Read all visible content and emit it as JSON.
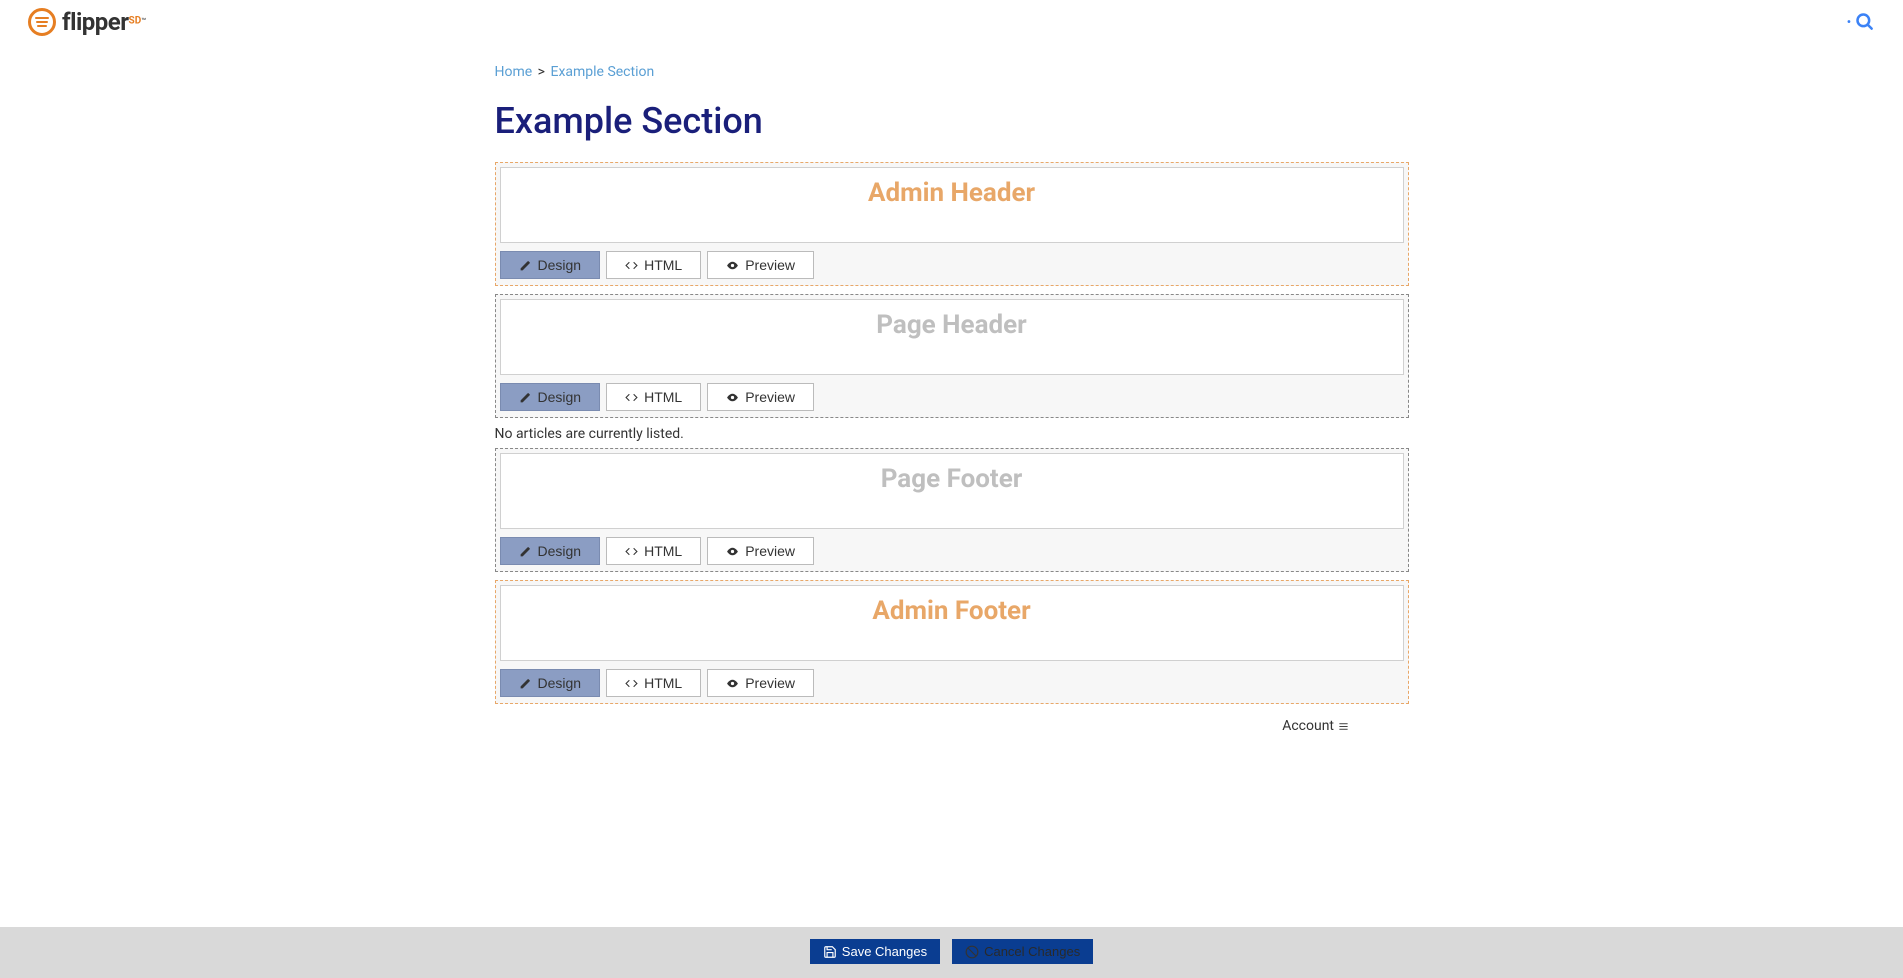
{
  "header": {
    "logo_text": "flipper",
    "logo_sd": "SD",
    "logo_tm": "™"
  },
  "breadcrumb": {
    "home": "Home",
    "sep": ">",
    "current": "Example Section"
  },
  "page_title": "Example Section",
  "sections": {
    "admin_header": "Admin Header",
    "page_header": "Page Header",
    "page_footer": "Page Footer",
    "admin_footer": "Admin Footer"
  },
  "tabs": {
    "design": "Design",
    "html": "HTML",
    "preview": "Preview"
  },
  "messages": {
    "no_articles": "No articles are currently listed."
  },
  "footer": {
    "account": "Account"
  },
  "actions": {
    "save": "Save Changes",
    "cancel": "Cancel Changes"
  }
}
